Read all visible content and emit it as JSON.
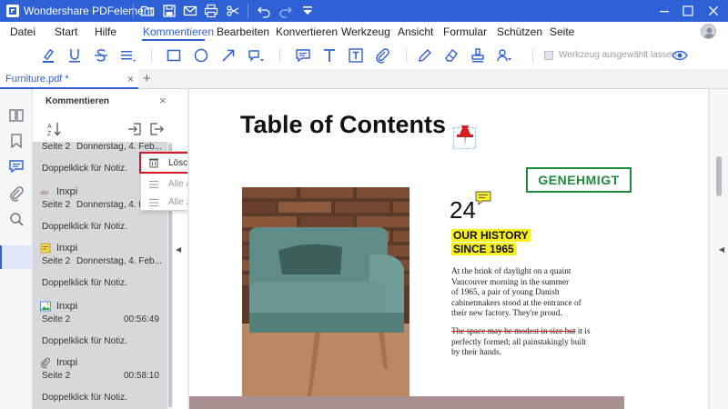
{
  "titlebar": {
    "app_title": "Wondershare PDFelement",
    "quick_access_icons": [
      "folder-open-icon",
      "save-icon",
      "mail-icon",
      "print-icon",
      "cut-icon",
      "undo-icon",
      "redo-icon",
      "customize-dropdown-icon"
    ],
    "window_controls": [
      "minimize-icon",
      "maximize-icon",
      "close-icon"
    ],
    "accent_color": "#2f61d6"
  },
  "menubar": {
    "items": [
      "Datei",
      "Start",
      "Hilfe",
      "Kommentieren",
      "Bearbeiten",
      "Konvertieren",
      "Werkzeug",
      "Ansicht",
      "Formular",
      "Schützen",
      "Seite"
    ],
    "active": "Kommentieren"
  },
  "toolbar": {
    "tools": [
      "highlight-icon",
      "underline-icon",
      "strikethrough-icon",
      "replace-text-icon",
      "rectangle-icon",
      "oval-icon",
      "arrow-icon",
      "shape-dropdown-icon",
      "sticky-note-icon",
      "text-icon",
      "text-box-icon",
      "attachment-icon",
      "pencil-icon",
      "eraser-icon",
      "stamp-icon",
      "signature-icon",
      "show-hide-icon"
    ],
    "keep_tool_selected_label": "Werkzeug ausgewählt lassen"
  },
  "tabs": {
    "doc_tab_label": "Furniture.pdf *",
    "close_glyph": "×",
    "add_glyph": "+"
  },
  "rail": {
    "icons": [
      "thumbnails-icon",
      "bookmark-icon",
      "comment-icon",
      "attachment-icon",
      "search-icon"
    ],
    "active": "comment-icon"
  },
  "panel": {
    "title": "Kommentieren",
    "close_glyph": "×",
    "tools": [
      "sort-icon",
      "import-icon",
      "export-icon"
    ],
    "comments": [
      {
        "icon": "",
        "author": "",
        "page": "Seite 2",
        "date": "Donnerstag, 4. Feb...",
        "note": "Doppelklick für Notiz."
      },
      {
        "icon": "text-abc-icon",
        "author": "Inxpi",
        "page": "Seite 2",
        "date": "Donnerstag, 4. Feb...",
        "note": "Doppelklick für Notiz."
      },
      {
        "icon": "sticky-note-icon",
        "author": "Inxpi",
        "page": "Seite 2",
        "date": "Donnerstag, 4. Feb...",
        "note": "Doppelklick für Notiz."
      },
      {
        "icon": "image-icon",
        "author": "Inxpi",
        "page": "Seite 2",
        "date": "00:56:49",
        "note": "Doppelklick für Notiz."
      },
      {
        "icon": "attachment-icon",
        "author": "Inxpi",
        "page": "Seite 2",
        "date": "00:58:10",
        "note": "Doppelklick für Notiz."
      }
    ]
  },
  "context_menu": {
    "items": [
      {
        "label": "Löschen",
        "icon": "trash-icon",
        "enabled": true,
        "highlighted": true
      },
      {
        "label": "Alle aufklappen",
        "icon": "expand-all-icon",
        "enabled": false,
        "highlighted": false
      },
      {
        "label": "Alle zuklappen",
        "icon": "collapse-all-icon",
        "enabled": false,
        "highlighted": false
      }
    ],
    "highlight_color": "#d4191f"
  },
  "document": {
    "title": "Table of Contents",
    "stamp": "GENEHMIGT",
    "stamp_color": "#1e8a3a",
    "number": "24",
    "history_line1": "OUR HISTORY",
    "history_line2": "SINCE 1965",
    "highlight_color": "#f7ef1e",
    "body_lines": [
      "At the brink of daylight on a quaint",
      "Vancouver morning in the summer",
      "of 1965, a pair of young Danish",
      "cabinetmakers stood at the entrance of",
      "their new factory. They're proud."
    ],
    "body2_strike": "The space may be modest in size but",
    "body2_rest_first": " it is",
    "body2_lines": [
      "perfectly formed; all painstakingly built",
      "by their hands."
    ]
  }
}
